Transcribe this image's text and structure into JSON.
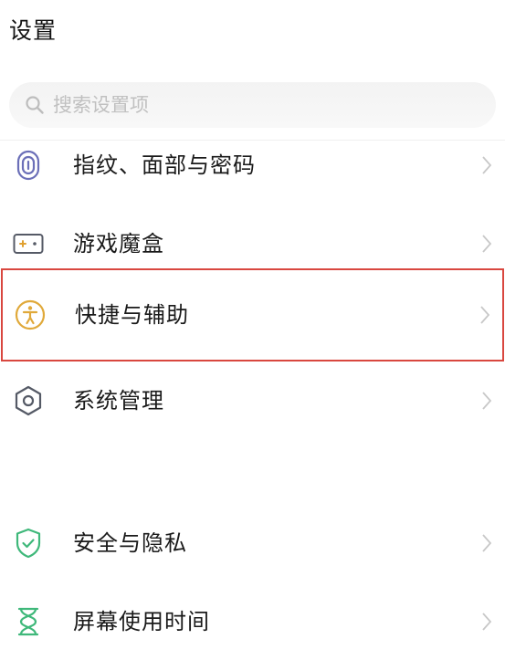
{
  "header": {
    "title": "设置"
  },
  "search": {
    "placeholder": "搜索设置项",
    "value": ""
  },
  "items": [
    {
      "label": "指纹、面部与密码",
      "icon": "fingerprint-icon",
      "color": "#6b6fb8"
    },
    {
      "label": "游戏魔盒",
      "icon": "game-box-icon",
      "color": "#e0a030"
    },
    {
      "label": "快捷与辅助",
      "icon": "accessibility-icon",
      "color": "#e0a93a",
      "highlighted": true
    },
    {
      "label": "系统管理",
      "icon": "hexagon-settings-icon",
      "color": "#555a66"
    },
    {
      "label": "安全与隐私",
      "icon": "shield-check-icon",
      "color": "#3fb87a"
    },
    {
      "label": "屏幕使用时间",
      "icon": "hourglass-icon",
      "color": "#3fb87a"
    }
  ],
  "colors": {
    "highlight_border": "#d9473f",
    "chevron": "#c8c8c8",
    "search_bg": "#f5f5f5"
  }
}
